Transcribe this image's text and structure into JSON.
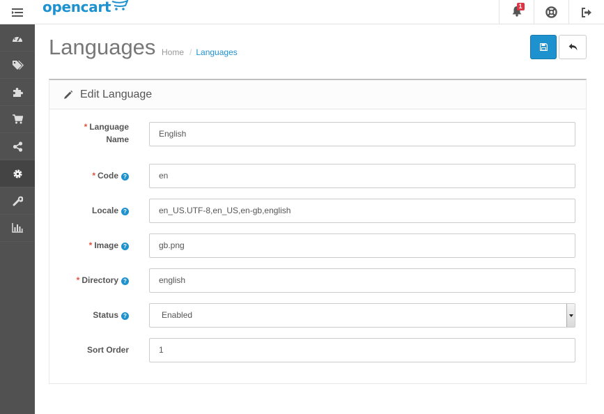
{
  "header": {
    "logo_text": "opencart",
    "alert_count": "1",
    "icons": [
      "menu-icon",
      "bell-icon",
      "life-ring-icon",
      "sign-out-icon"
    ]
  },
  "sidebar": {
    "items": [
      {
        "icon": "dashboard-icon",
        "active": false
      },
      {
        "icon": "tags-icon",
        "active": false
      },
      {
        "icon": "puzzle-icon",
        "active": false
      },
      {
        "icon": "cart-icon",
        "active": false
      },
      {
        "icon": "share-icon",
        "active": false
      },
      {
        "icon": "cog-icon",
        "active": true
      },
      {
        "icon": "wrench-icon",
        "active": false
      },
      {
        "icon": "bar-chart-icon",
        "active": false
      }
    ]
  },
  "page": {
    "title": "Languages",
    "breadcrumb": {
      "home": "Home",
      "separator": "/",
      "current": "Languages"
    },
    "colors": {
      "primary": "#1e91cf",
      "required": "#e3503e",
      "sidebar": "#515151"
    }
  },
  "panel": {
    "title": "Edit Language",
    "title_icon": "pencil-icon"
  },
  "form": {
    "language_name": {
      "label_line1": "Language",
      "label_line2": "Name",
      "required": true,
      "value": "English"
    },
    "code": {
      "label": "Code",
      "required": true,
      "help": true,
      "value": "en"
    },
    "locale": {
      "label": "Locale",
      "required": false,
      "help": true,
      "value": "en_US.UTF-8,en_US,en-gb,english"
    },
    "image": {
      "label": "Image",
      "required": true,
      "help": true,
      "value": "gb.png"
    },
    "directory": {
      "label": "Directory",
      "required": true,
      "help": true,
      "value": "english"
    },
    "status": {
      "label": "Status",
      "required": false,
      "help": true,
      "value": "Enabled"
    },
    "sort_order": {
      "label": "Sort Order",
      "required": false,
      "help": false,
      "value": "1"
    }
  },
  "glyphs": {
    "required": "*",
    "help": "?"
  }
}
